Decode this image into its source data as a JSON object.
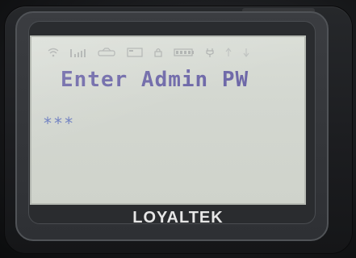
{
  "device": {
    "brand": "LOYALTEK"
  },
  "screen": {
    "prompt": "Enter Admin PW",
    "password_mask": "***"
  },
  "status_icons": [
    "wifi-icon",
    "signal-bars-icon",
    "connection-icon",
    "card-icon",
    "lock-icon",
    "battery-icon",
    "power-plug-icon",
    "arrow-up-icon",
    "arrow-down-icon"
  ],
  "colors": {
    "lcd_background": "#d6dad3",
    "text_purple": "#6e68a8",
    "text_blue": "#6e7fc0",
    "brand_text": "#e6e6e6",
    "device_body": "#1f2023"
  }
}
